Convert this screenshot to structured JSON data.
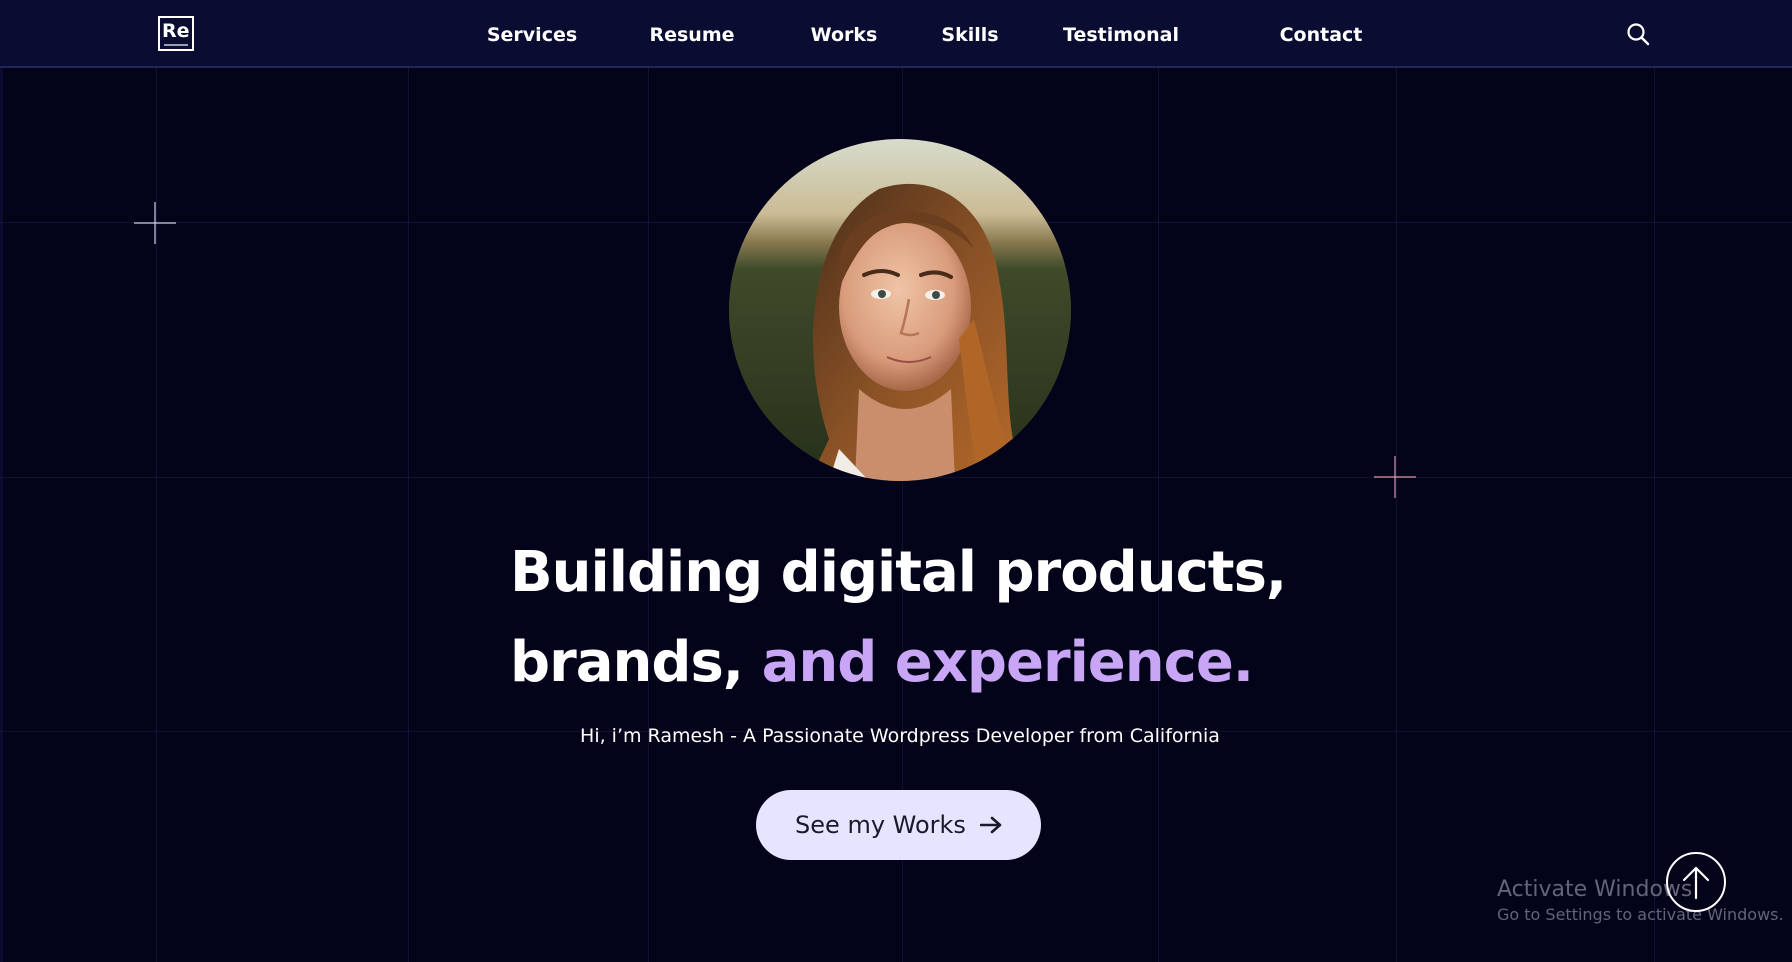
{
  "logo": {
    "text": "Re"
  },
  "nav": {
    "items": [
      {
        "label": "Services"
      },
      {
        "label": "Resume"
      },
      {
        "label": "Works"
      },
      {
        "label": "Skills"
      },
      {
        "label": "Testimonal"
      },
      {
        "label": "Contact"
      }
    ],
    "search_icon": "search-icon"
  },
  "hero": {
    "line1": "Building digital products,",
    "line2_plain": "brands,",
    "line2_accent": "and experience.",
    "subtitle": "Hi, i’m Ramesh - A Passionate Wordpress Developer from California",
    "cta_label": "See my Works",
    "cta_icon": "arrow-right-icon",
    "avatar": "portrait-photo"
  },
  "scroll_top": {
    "icon": "arrow-up-icon"
  },
  "watermark": {
    "title": "Activate Windows",
    "subtitle": "Go to Settings to activate Windows."
  },
  "colors": {
    "background": "#030319",
    "navbar": "#0b0c32",
    "accent": "#c9a6f5",
    "button_bg": "#e6e4ff",
    "button_text": "#1a1a2b"
  }
}
